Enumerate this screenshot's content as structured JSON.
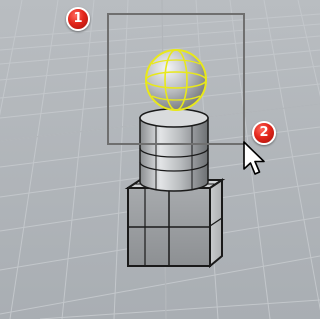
{
  "callouts": {
    "first": "1",
    "second": "2"
  },
  "icons": {
    "cursor": "mouse-pointer-arrow-icon"
  },
  "colors": {
    "viewport_background": "#aeb3b8",
    "grid_line": "#c2c6ca",
    "selection_window": "#6f6f6f",
    "selected_highlight": "#e8e81a",
    "callout_red": "#e3261b"
  }
}
